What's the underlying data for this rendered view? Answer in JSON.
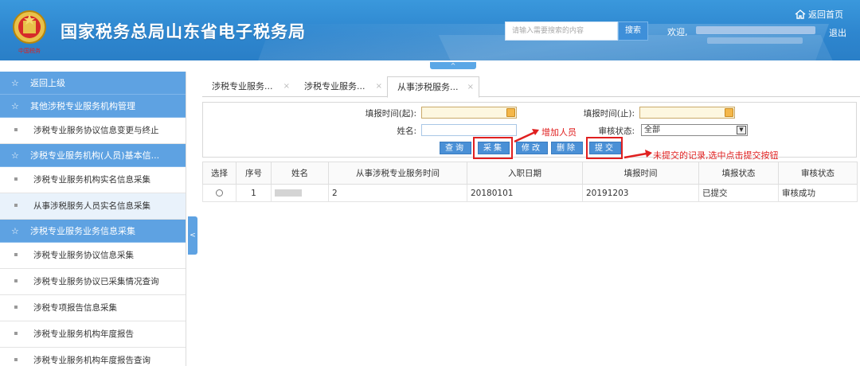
{
  "header": {
    "site_title": "国家税务总局山东省电子税务局",
    "emblem_text": "中国税务",
    "search_placeholder": "请输入需要搜索的内容",
    "search_button": "搜索",
    "welcome": "欢迎,",
    "home_link": "返回首页",
    "logout": "退出"
  },
  "collapse_top": "^",
  "sidebar": {
    "items": [
      {
        "type": "group",
        "icon": "star-icon",
        "label": "返回上级"
      },
      {
        "type": "group",
        "icon": "star-icon",
        "label": "其他涉税专业服务机构管理"
      },
      {
        "type": "item",
        "label": "涉税专业服务协议信息变更与终止"
      },
      {
        "type": "group",
        "icon": "star-icon",
        "label": "涉税专业服务机构(人员)基本信..."
      },
      {
        "type": "item",
        "label": "涉税专业服务机构实名信息采集"
      },
      {
        "type": "item",
        "label": "从事涉税服务人员实名信息采集",
        "active": true
      },
      {
        "type": "group",
        "icon": "star-icon",
        "label": "涉税专业服务业务信息采集"
      },
      {
        "type": "item",
        "label": "涉税专业服务协议信息采集"
      },
      {
        "type": "item",
        "label": "涉税专业服务协议已采集情况查询"
      },
      {
        "type": "item",
        "label": "涉税专项报告信息采集"
      },
      {
        "type": "item",
        "label": "涉税专业服务机构年度报告"
      },
      {
        "type": "item",
        "label": "涉税专业服务机构年度报告查询"
      }
    ],
    "toggle": "<"
  },
  "tabs": [
    {
      "label": "涉税专业服务...",
      "active": false
    },
    {
      "label": "涉税专业服务...",
      "active": false
    },
    {
      "label": "从事涉税服务...",
      "active": true
    }
  ],
  "tab_close": "×",
  "query": {
    "start_label": "填报时间(起):",
    "end_label": "填报时间(止):",
    "name_label": "姓名:",
    "status_label": "审核状态:",
    "status_value": "全部",
    "status_arrow": "▼"
  },
  "buttons": {
    "query": "查询",
    "collect": "采集",
    "edit": "修改",
    "delete": "删除",
    "submit": "提交"
  },
  "annotations": {
    "add_person": "增加人员",
    "submit_note": "未提交的记录,选中点击提交按钮"
  },
  "table": {
    "headers": [
      "选择",
      "序号",
      "姓名",
      "从事涉税专业服务时间",
      "入职日期",
      "填报时间",
      "填报状态",
      "审核状态"
    ],
    "rows": [
      {
        "index": "1",
        "years": "2",
        "entry_date": "20180101",
        "fill_date": "20191203",
        "fill_status": "已提交",
        "audit_status": "审核成功"
      }
    ]
  },
  "colors": {
    "header_blue": "#2e86cf",
    "sidebar_group": "#5ea2e2",
    "button_blue": "#4a90d6",
    "annotation_red": "#e02020"
  }
}
